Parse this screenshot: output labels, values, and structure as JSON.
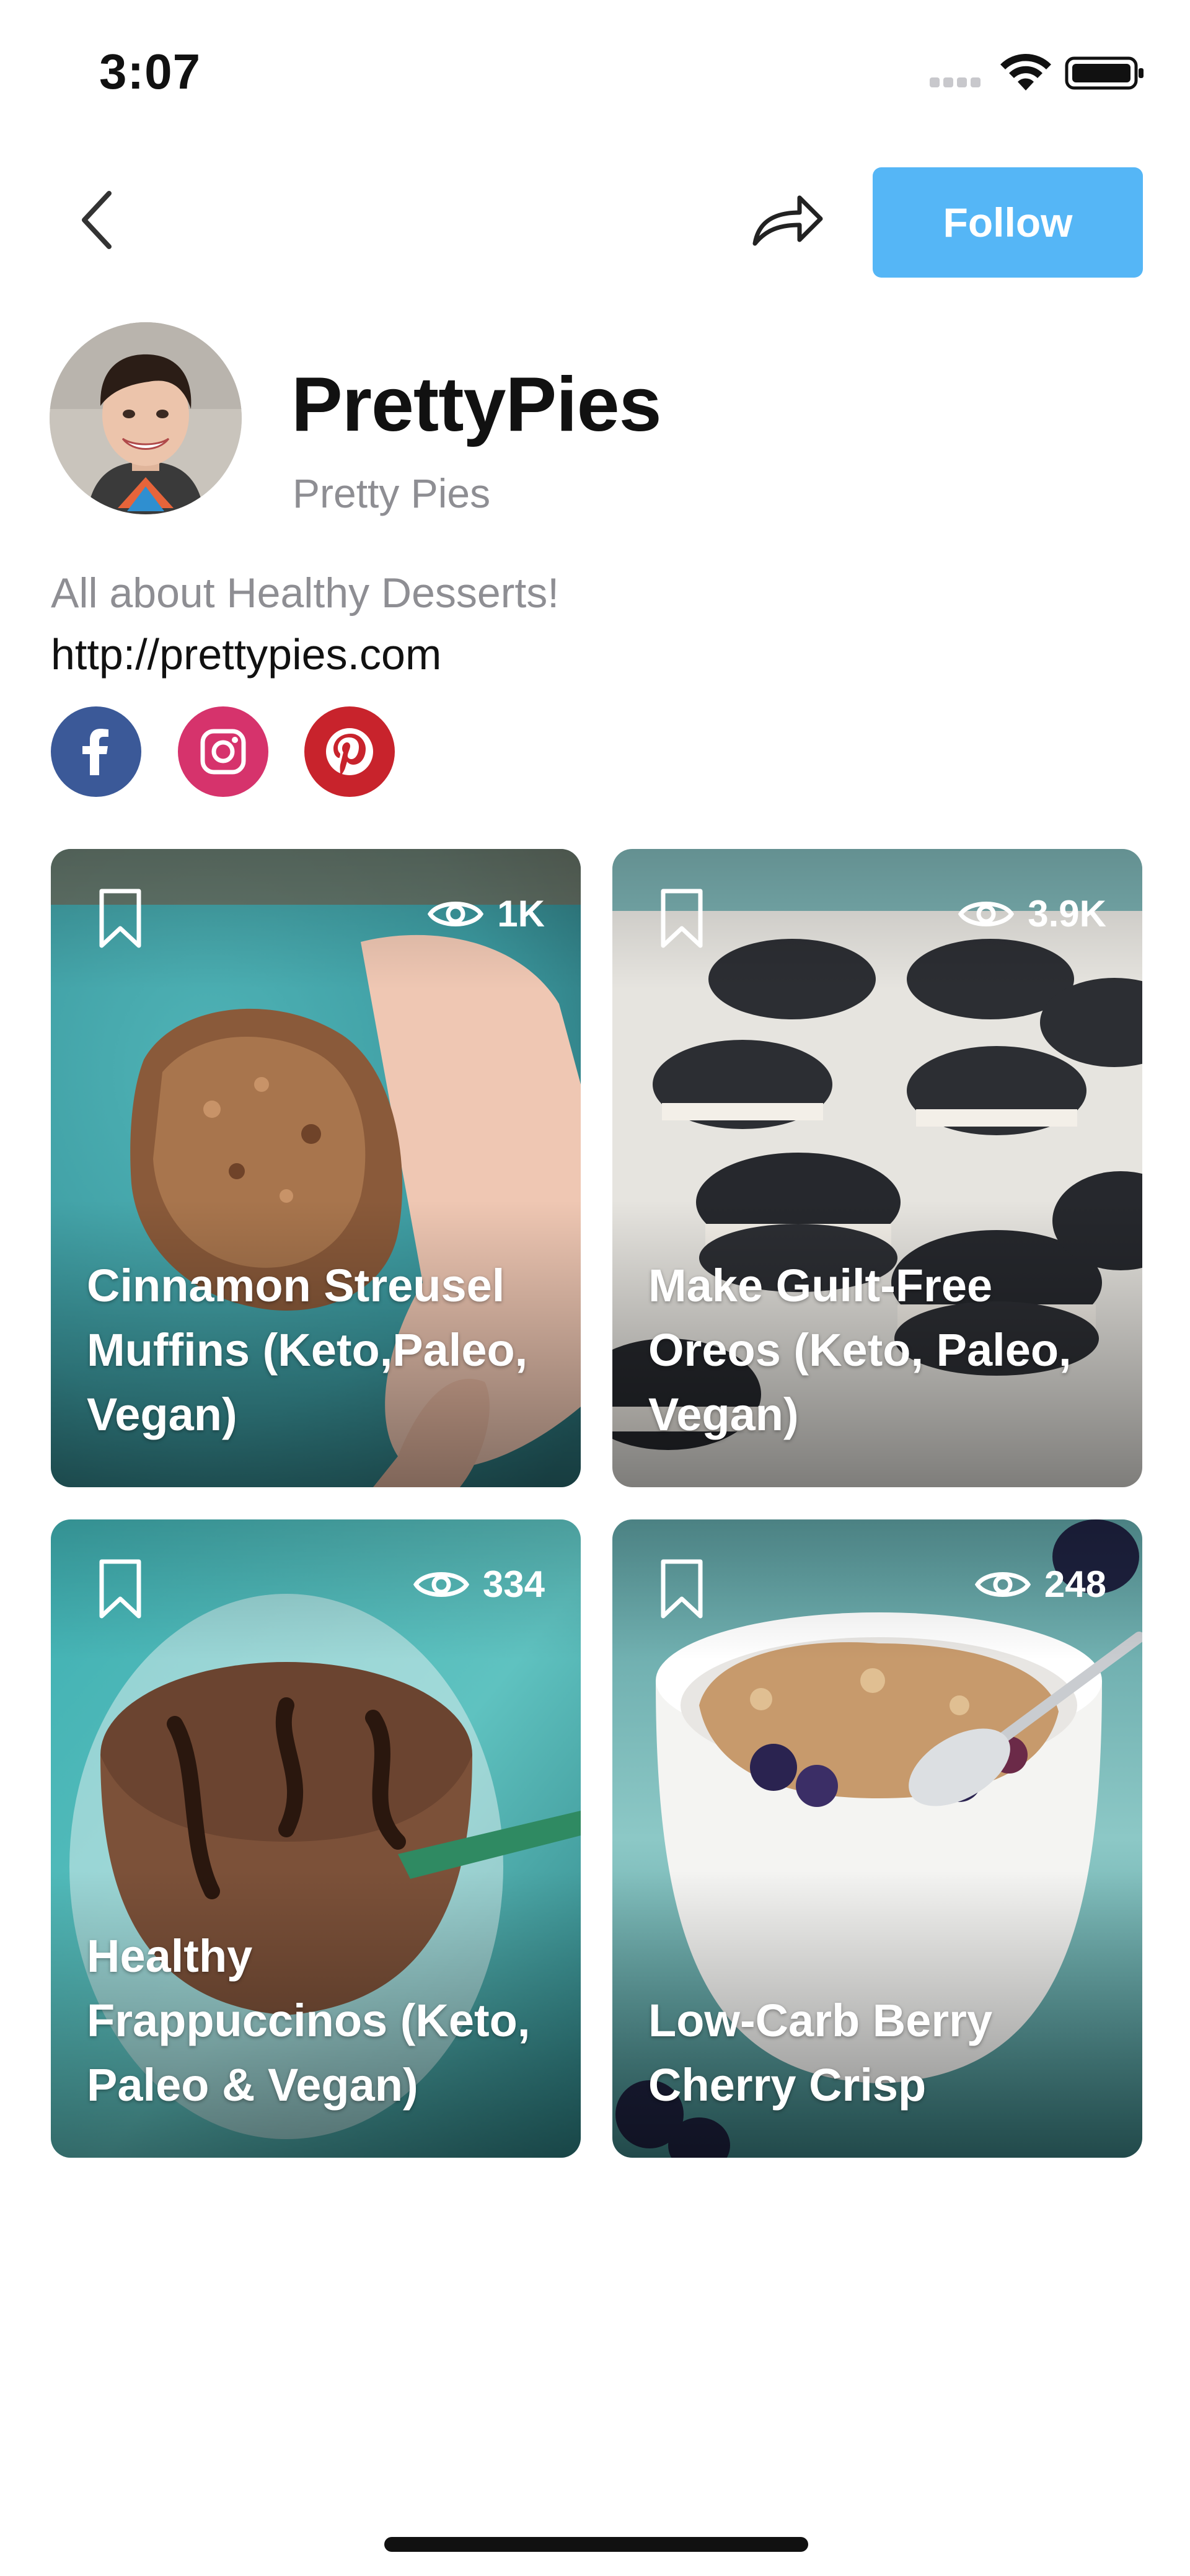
{
  "status_bar": {
    "time": "3:07",
    "icons": [
      "signal-icon",
      "wifi-icon",
      "battery-icon"
    ]
  },
  "nav": {
    "back_icon": "chevron-left-icon",
    "share_icon": "share-arrow-icon",
    "follow_label": "Follow",
    "follow_color": "#55b6f6"
  },
  "profile": {
    "name": "PrettyPies",
    "handle": "Pretty Pies",
    "bio": "All about Healthy Desserts!",
    "website": "http://prettypies.com",
    "social": [
      {
        "icon": "facebook-icon",
        "color": "#3b5998"
      },
      {
        "icon": "instagram-icon",
        "color": "#d6336c"
      },
      {
        "icon": "pinterest-icon",
        "color": "#c8232c"
      }
    ]
  },
  "posts": [
    {
      "title": "Cinnamon Streusel Muffins (Keto,Paleo, Vegan)",
      "views": "1K"
    },
    {
      "title": "Make Guilt-Free Oreos (Keto, Paleo, Vegan)",
      "views": "3.9K"
    },
    {
      "title": "Healthy Frappuccinos (Keto, Paleo & Vegan)",
      "views": "334"
    },
    {
      "title": "Low-Carb Berry Cherry Crisp",
      "views": "248"
    }
  ]
}
